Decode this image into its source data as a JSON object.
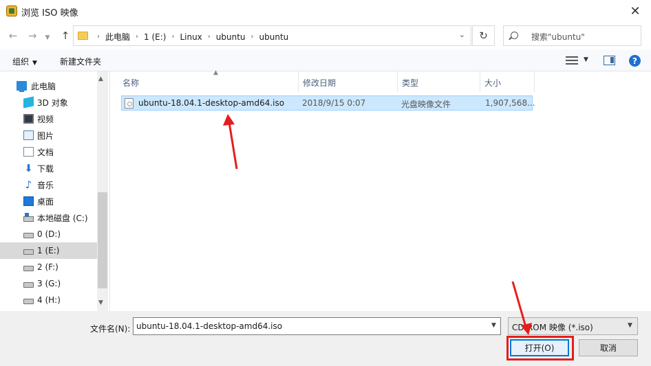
{
  "window": {
    "title": "浏览 ISO 映像"
  },
  "address": {
    "crumbs": [
      "此电脑",
      "1 (E:)",
      "Linux",
      "ubuntu",
      "ubuntu"
    ]
  },
  "search": {
    "placeholder": "搜索\"ubuntu\""
  },
  "toolbar": {
    "organize": "组织",
    "new_folder": "新建文件夹"
  },
  "sidebar": {
    "items": [
      {
        "label": "此电脑",
        "icon": "computer-icon"
      },
      {
        "label": "3D 对象",
        "icon": "3d-objects-icon"
      },
      {
        "label": "视频",
        "icon": "video-icon"
      },
      {
        "label": "图片",
        "icon": "pictures-icon"
      },
      {
        "label": "文档",
        "icon": "documents-icon"
      },
      {
        "label": "下载",
        "icon": "download-icon"
      },
      {
        "label": "音乐",
        "icon": "music-icon"
      },
      {
        "label": "桌面",
        "icon": "desktop-icon"
      },
      {
        "label": "本地磁盘 (C:)",
        "icon": "local-disk-icon"
      },
      {
        "label": "0 (D:)",
        "icon": "drive-icon"
      },
      {
        "label": "1 (E:)",
        "icon": "drive-icon",
        "selected": true
      },
      {
        "label": "2 (F:)",
        "icon": "drive-icon"
      },
      {
        "label": "3 (G:)",
        "icon": "drive-icon"
      },
      {
        "label": "4 (H:)",
        "icon": "drive-icon"
      }
    ]
  },
  "columns": {
    "name": "名称",
    "date": "修改日期",
    "type": "类型",
    "size": "大小"
  },
  "files": [
    {
      "name": "ubuntu-18.04.1-desktop-amd64.iso",
      "date": "2018/9/15 0:07",
      "type": "光盘映像文件",
      "size": "1,907,568...",
      "selected": true
    }
  ],
  "footer": {
    "filename_label": "文件名(N):",
    "filename_value": "ubuntu-18.04.1-desktop-amd64.iso",
    "filetype_value": "CD-ROM 映像 (*.iso)",
    "open_label": "打开(O)",
    "cancel_label": "取消"
  },
  "annotation_color": "#e51d1d"
}
